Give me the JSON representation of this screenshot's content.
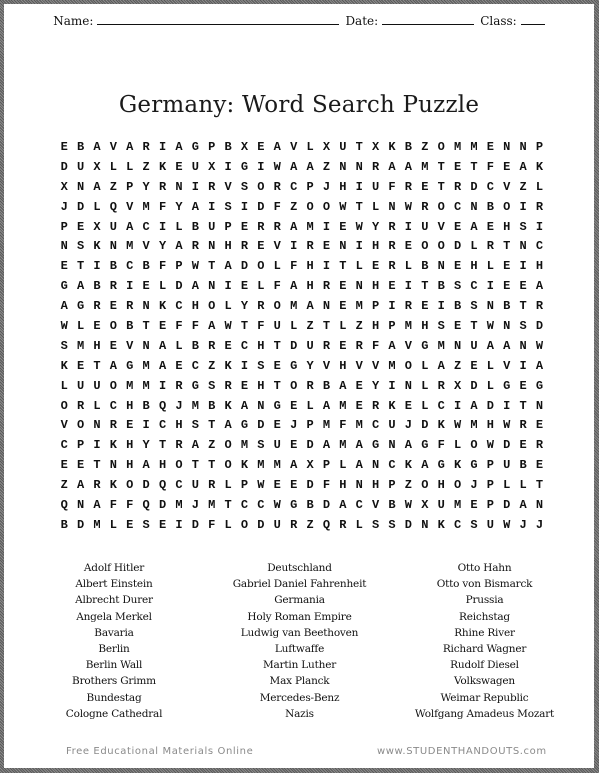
{
  "header": {
    "name_label": "Name:",
    "date_label": "Date:",
    "class_label": "Class:"
  },
  "title": "Germany: Word Search Puzzle",
  "grid_rows": [
    "EBAVARIAGPBXEAVLXUTXKBZOMMENNP",
    "DUXLLZKEUXIGIWAAZNNRAAMTETFEAK",
    "XNAZPYRNIRVSORCPJHIUFRETRDCVZL",
    "JDLQVMFYAISIDFZOOWTLNWROCNBOIR",
    "PEXUACILBUPERRAMIEWYRIUVEAEHSI",
    "NSKNMVYARNHREVIRENIHREOODLRTNC",
    "ETIBCBFPWTADOLFHITLERLBNEHLEIH",
    "GABRIELDANIELFAHRENHEITBSCIEEA",
    "AGRERNKCHOLYROMANEMPIREIBSNBTR",
    "WLEOBTEFFAWTFULZTLZHPMHSETWNSD",
    "SMHEVNALBRECHTDURERFAVGMNUAANW",
    "KETAGMAECZKISEGYVHVVMOLAZELVIA",
    "LUUOMMIRGSREHTORBAEYINLRXDLGEG",
    "ORLCHBQJMBKANGELAMERKELCIADITN",
    "VONREICHSTAGDEJPMFMCUJDKWMHWRE",
    "CPIKHYTRAZOMSUEDAMAGNAGFLOWDER",
    "EETNHAHOTTOKMMAXPLANCKAGKGPUBE",
    "ZARKODQCURLPWEEDFHNHPZOHOJPLLT",
    "QNAFFQDMJMTCCWGBDACVBWXUMEPDAN",
    "BDMLESEIDFLODURZQRLSSDNKCSUWJJ"
  ],
  "word_columns": [
    [
      "Adolf Hitler",
      "Albert Einstein",
      "Albrecht Durer",
      "Angela Merkel",
      "Bavaria",
      "Berlin",
      "Berlin Wall",
      "Brothers Grimm",
      "Bundestag",
      "Cologne Cathedral"
    ],
    [
      "Deutschland",
      "Gabriel Daniel Fahrenheit",
      "Germania",
      "Holy Roman Empire",
      "Ludwig van Beethoven",
      "Luftwaffe",
      "Martin Luther",
      "Max Planck",
      "Mercedes-Benz",
      "Nazis"
    ],
    [
      "Otto Hahn",
      "Otto von Bismarck",
      "Prussia",
      "Reichstag",
      "Rhine River",
      "Richard Wagner",
      "Rudolf Diesel",
      "Volkswagen",
      "Weimar Republic",
      "Wolfgang Amadeus Mozart"
    ]
  ],
  "footer": {
    "left": "Free Educational Materials Online",
    "right": "www.STUDENTHANDOUTS.com"
  }
}
